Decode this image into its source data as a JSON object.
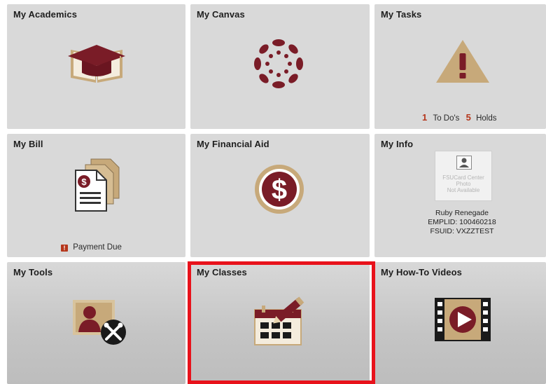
{
  "tiles": {
    "academics": {
      "title": "My Academics"
    },
    "canvas": {
      "title": "My Canvas"
    },
    "tasks": {
      "title": "My Tasks",
      "todo_count": "1",
      "todo_label": "To Do's",
      "holds_count": "5",
      "holds_label": "Holds"
    },
    "bill": {
      "title": "My Bill",
      "status": "Payment Due"
    },
    "financial_aid": {
      "title": "My Financial Aid"
    },
    "info": {
      "title": "My Info",
      "photo_placeholder": [
        "FSUCard Center",
        "Photo",
        "Not Available"
      ],
      "name": "Ruby Renegade",
      "emplid": "EMPLID: 100460218",
      "fsuid": "FSUID: VXZZTEST"
    },
    "tools": {
      "title": "My Tools"
    },
    "classes": {
      "title": "My Classes"
    },
    "videos": {
      "title": "My How-To Videos"
    }
  },
  "colors": {
    "garnet": "#7a1c27",
    "gold": "#c7a97a",
    "highlight": "#e8121b",
    "alert": "#b5361b"
  },
  "selected_tile": "classes"
}
